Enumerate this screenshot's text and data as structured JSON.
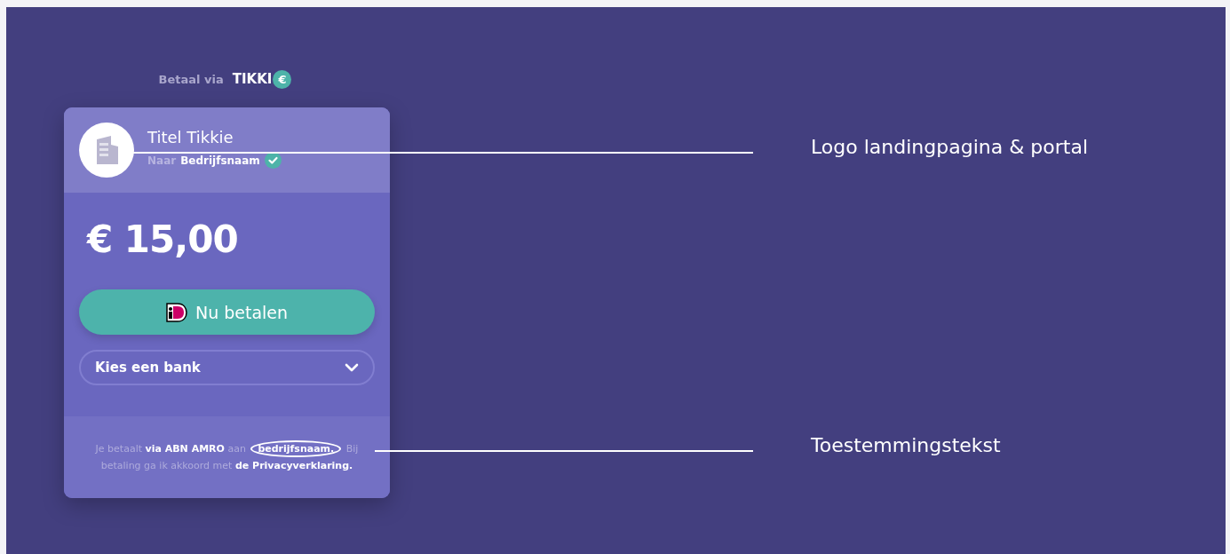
{
  "brand": {
    "prefix": "Betaal via",
    "name": "TIKKI",
    "mark": "€"
  },
  "card": {
    "title": "Titel Tikkie",
    "recipient_prefix": "Naar",
    "recipient": "Bedrijfsnaam",
    "verified": true,
    "amount": "€ 15,00",
    "pay_button": "Nu betalen",
    "bank_select": {
      "placeholder": "Kies een bank"
    },
    "consent": "Je betaalt **via ABN AMRO** aan **bedrijfsnaam.** Bij betaling ga ik akkoord met **de Privacyverklaring.**"
  },
  "annotations": [
    {
      "label": "Logo landingpagina & portal"
    },
    {
      "label": "Toestemmingstekst"
    }
  ]
}
